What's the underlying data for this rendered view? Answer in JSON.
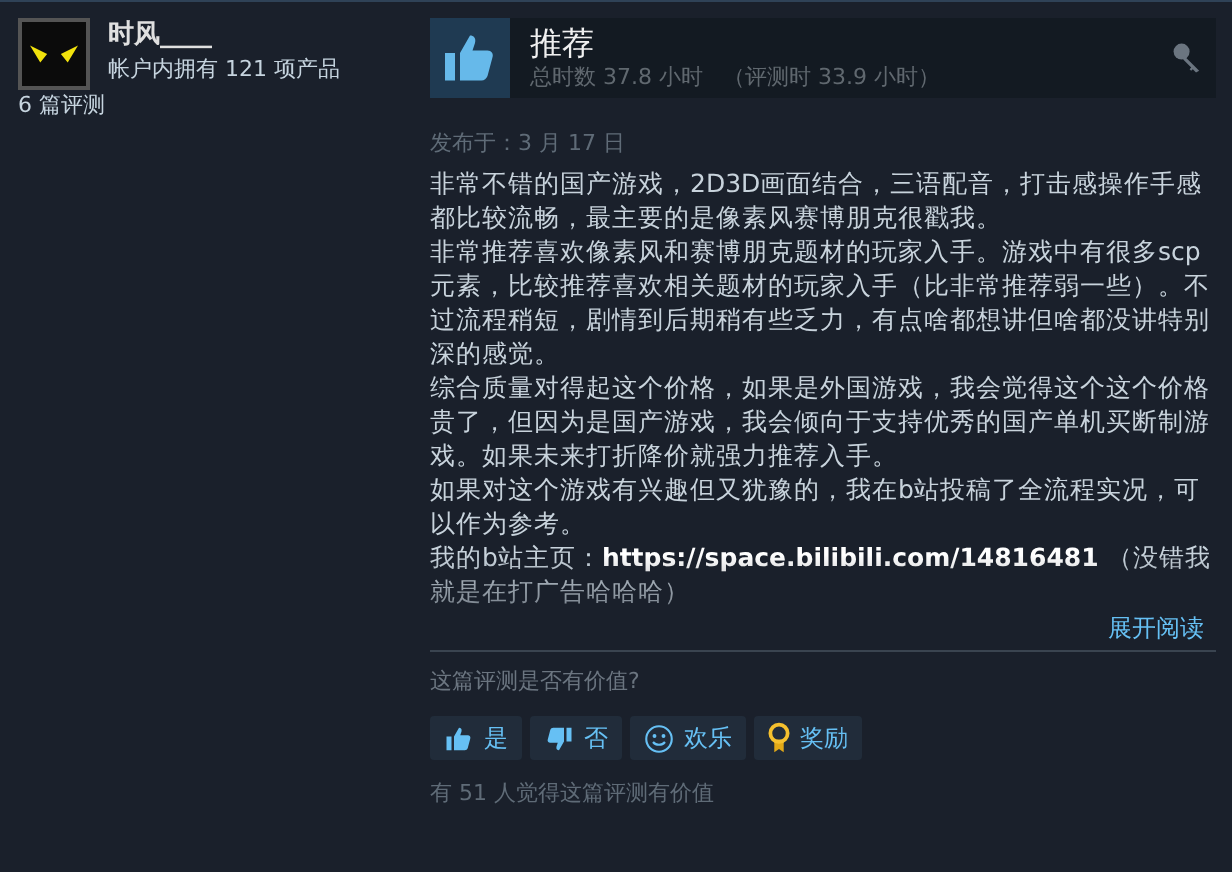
{
  "author": {
    "name": "时风____",
    "products": "帐户内拥有 121 项产品",
    "reviews": "6 篇评测"
  },
  "review": {
    "verdict": "推荐",
    "recommended": true,
    "hours": "总时数 37.8 小时",
    "review_hours": "（评测时 33.9 小时）",
    "posted": "发布于：3 月 17 日",
    "paragraphs": [
      {
        "text": "非常不错的国产游戏，2D3D画面结合，三语配音，打击感操作手感都比较流畅，最主要的是像素风赛博朋克很戳我。"
      },
      {
        "text": "非常推荐喜欢像素风和赛博朋克题材的玩家入手。游戏中有很多scp元素，比较推荐喜欢相关题材的玩家入手（比非常推荐弱一些）。不过流程稍短，剧情到后期稍有些乏力，有点啥都想讲但啥都没讲特别深的感觉。"
      },
      {
        "text": "综合质量对得起这个价格，如果是外国游戏，我会觉得这个这个价格贵了，但因为是国产游戏，我会倾向于支持优秀的国产单机买断制游戏。如果未来打折降价就强力推荐入手。"
      },
      {
        "text": "如果对这个游戏有兴趣但又犹豫的，我在b站投稿了全流程实况，可以作为参考。"
      },
      {
        "text": "我的b站主页：",
        "link": "https://space.bilibili.com/14816481",
        "after": " （没错我就是在打广告哈哈哈）"
      }
    ],
    "read_more": "展开阅读",
    "question": "这篇评测是否有价值?",
    "buttons": [
      {
        "kind": "yes",
        "label": "是"
      },
      {
        "kind": "no",
        "label": "否"
      },
      {
        "kind": "funny",
        "label": "欢乐"
      },
      {
        "kind": "award",
        "label": "奖励"
      }
    ],
    "helpful": "有 51 人觉得这篇评测有价值"
  }
}
